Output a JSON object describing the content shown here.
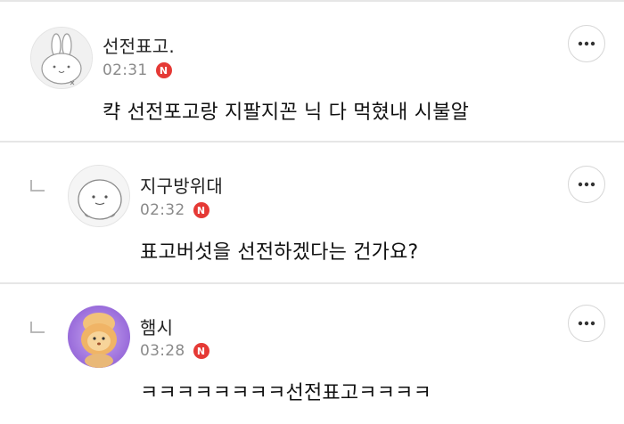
{
  "comments": [
    {
      "author": "선전표고.",
      "time": "02:31",
      "badge": "N",
      "text": "캭 선전포고랑 지팔지꼰 닉 다 먹혔내 시불알",
      "avatar": "rabbit-avatar",
      "is_reply": false
    },
    {
      "author": "지구방위대",
      "time": "02:32",
      "badge": "N",
      "text": "표고버섯을 선전하겠다는 건가요?",
      "avatar": "blob-avatar",
      "is_reply": true
    },
    {
      "author": "햄시",
      "time": "03:28",
      "badge": "N",
      "text": "ㅋㅋㅋㅋㅋㅋㅋㅋ선전표고ㅋㅋㅋㅋ",
      "avatar": "photo-avatar",
      "is_reply": true
    }
  ],
  "icons": {
    "more": "more-options-icon",
    "reply": "reply-arrow-icon",
    "badge": "new-badge"
  },
  "colors": {
    "badge": "#e53935",
    "time": "#8a8a8a",
    "divider": "#e6e6e6",
    "purple_avatar_bg": "#a070d8"
  }
}
